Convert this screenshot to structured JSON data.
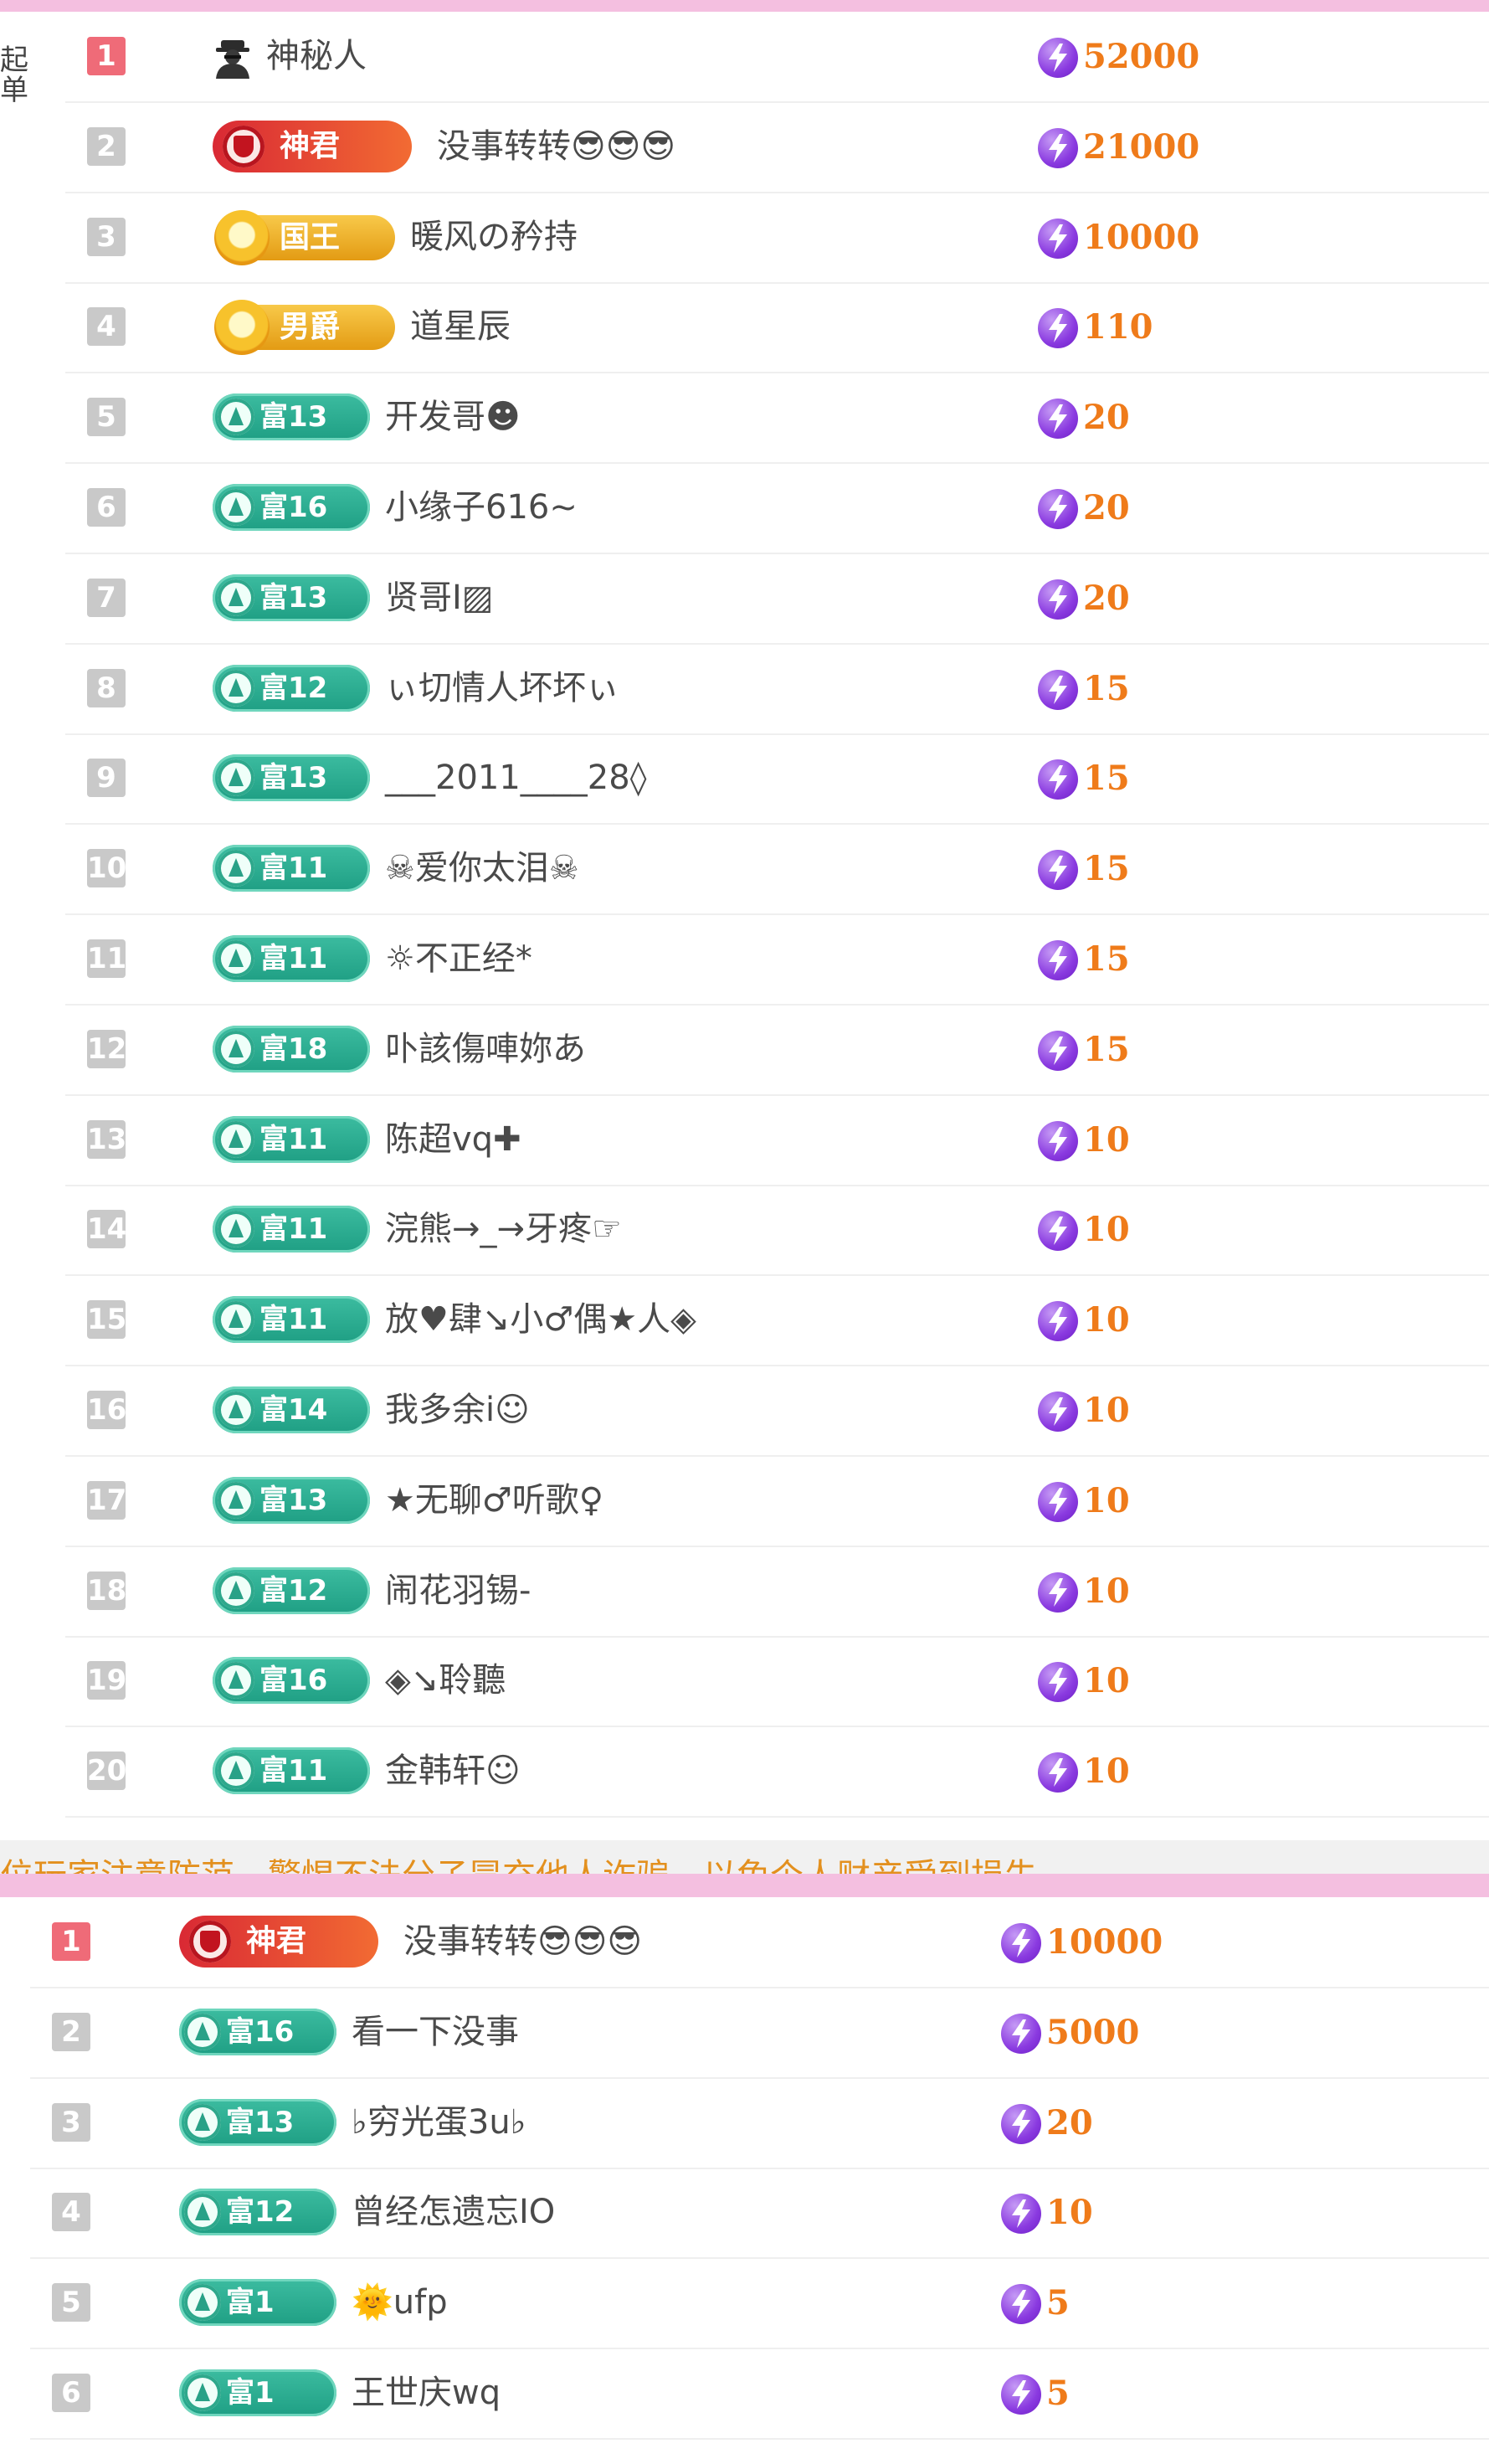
{
  "colors": {
    "accent_pink": "#f4bfe0",
    "score_orange": "#ef7b1a",
    "rank_top": "#ef6b78",
    "rank_default": "#c9c9c9",
    "rich_badge_green": "#2aa98c",
    "notice_orange": "#e3901e"
  },
  "panel1": {
    "side_label": "起单",
    "rows": [
      {
        "rank": "1",
        "badge_type": "mystery",
        "badge_text": "",
        "name": "神秘人",
        "score": "52000"
      },
      {
        "rank": "2",
        "badge_type": "god",
        "badge_text": "神君",
        "name": "没事转转😎😎😎",
        "score": "21000"
      },
      {
        "rank": "3",
        "badge_type": "noble",
        "badge_text": "国王",
        "name": "暖风の矜持",
        "score": "10000"
      },
      {
        "rank": "4",
        "badge_type": "noble",
        "badge_text": "男爵",
        "name": "道星辰",
        "score": "110"
      },
      {
        "rank": "5",
        "badge_type": "rich",
        "badge_text": "富13",
        "name": "开发哥☻",
        "score": "20"
      },
      {
        "rank": "6",
        "badge_type": "rich",
        "badge_text": "富16",
        "name": "小缘子616~",
        "score": "20"
      },
      {
        "rank": "7",
        "badge_type": "rich",
        "badge_text": "富13",
        "name": "贤哥I▨",
        "score": "20"
      },
      {
        "rank": "8",
        "badge_type": "rich",
        "badge_text": "富12",
        "name": "ぃ切情人坏坏ぃ",
        "score": "15"
      },
      {
        "rank": "9",
        "badge_type": "rich",
        "badge_text": "富13",
        "name": "___2011____28◊",
        "score": "15"
      },
      {
        "rank": "10",
        "badge_type": "rich",
        "badge_text": "富11",
        "name": "☠爱你太泪☠",
        "score": "15"
      },
      {
        "rank": "11",
        "badge_type": "rich",
        "badge_text": "富11",
        "name": "☼不正经*",
        "score": "15"
      },
      {
        "rank": "12",
        "badge_type": "rich",
        "badge_text": "富18",
        "name": "卟該傷唓妳あ",
        "score": "15"
      },
      {
        "rank": "13",
        "badge_type": "rich",
        "badge_text": "富11",
        "name": "陈超vq✚",
        "score": "10"
      },
      {
        "rank": "14",
        "badge_type": "rich",
        "badge_text": "富11",
        "name": "浣熊→_→牙疼☞",
        "score": "10"
      },
      {
        "rank": "15",
        "badge_type": "rich",
        "badge_text": "富11",
        "name": "放♥肆↘小♂偶★人◈",
        "score": "10"
      },
      {
        "rank": "16",
        "badge_type": "rich",
        "badge_text": "富14",
        "name": "我多余i☺",
        "score": "10"
      },
      {
        "rank": "17",
        "badge_type": "rich",
        "badge_text": "富13",
        "name": "★无聊♂听歌♀",
        "score": "10"
      },
      {
        "rank": "18",
        "badge_type": "rich",
        "badge_text": "富12",
        "name": "闹花羽锡-",
        "score": "10"
      },
      {
        "rank": "19",
        "badge_type": "rich",
        "badge_text": "富16",
        "name": "◈↘聆聽",
        "score": "10"
      },
      {
        "rank": "20",
        "badge_type": "rich",
        "badge_text": "富11",
        "name": "金韩轩☺",
        "score": "10"
      }
    ]
  },
  "notice": {
    "text": "位玩家注意防范，警惕不法分子冒充他人诈骗，以免个人财产受到损失"
  },
  "panel2": {
    "rows": [
      {
        "rank": "1",
        "badge_type": "god",
        "badge_text": "神君",
        "name": "没事转转😎😎😎",
        "score": "10000"
      },
      {
        "rank": "2",
        "badge_type": "rich",
        "badge_text": "富16",
        "name": "看一下没事",
        "score": "5000"
      },
      {
        "rank": "3",
        "badge_type": "rich",
        "badge_text": "富13",
        "name": "♭穷光蛋3u♭",
        "score": "20"
      },
      {
        "rank": "4",
        "badge_type": "rich",
        "badge_text": "富12",
        "name": "曾经怎遗忘IO",
        "score": "10"
      },
      {
        "rank": "5",
        "badge_type": "rich",
        "badge_text": "富1",
        "name": "🌞ufp",
        "score": "5"
      },
      {
        "rank": "6",
        "badge_type": "rich",
        "badge_text": "富1",
        "name": "王世庆wq",
        "score": "5"
      }
    ]
  }
}
